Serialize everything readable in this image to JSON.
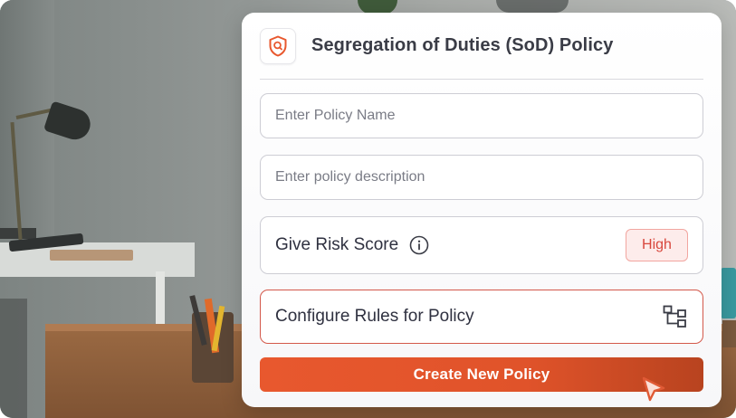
{
  "header": {
    "title": "Segregation of Duties (SoD) Policy",
    "icon": "shield-search-icon"
  },
  "form": {
    "policy_name_placeholder": "Enter Policy Name",
    "policy_description_placeholder": "Enter policy description",
    "risk_score_label": "Give Risk Score",
    "risk_score_value": "High",
    "configure_rules_label": "Configure Rules for Policy",
    "create_button_label": "Create New Policy"
  },
  "colors": {
    "accent": "#e8582e",
    "risk_high_text": "#d8473d",
    "risk_high_bg": "#fdeceb"
  }
}
